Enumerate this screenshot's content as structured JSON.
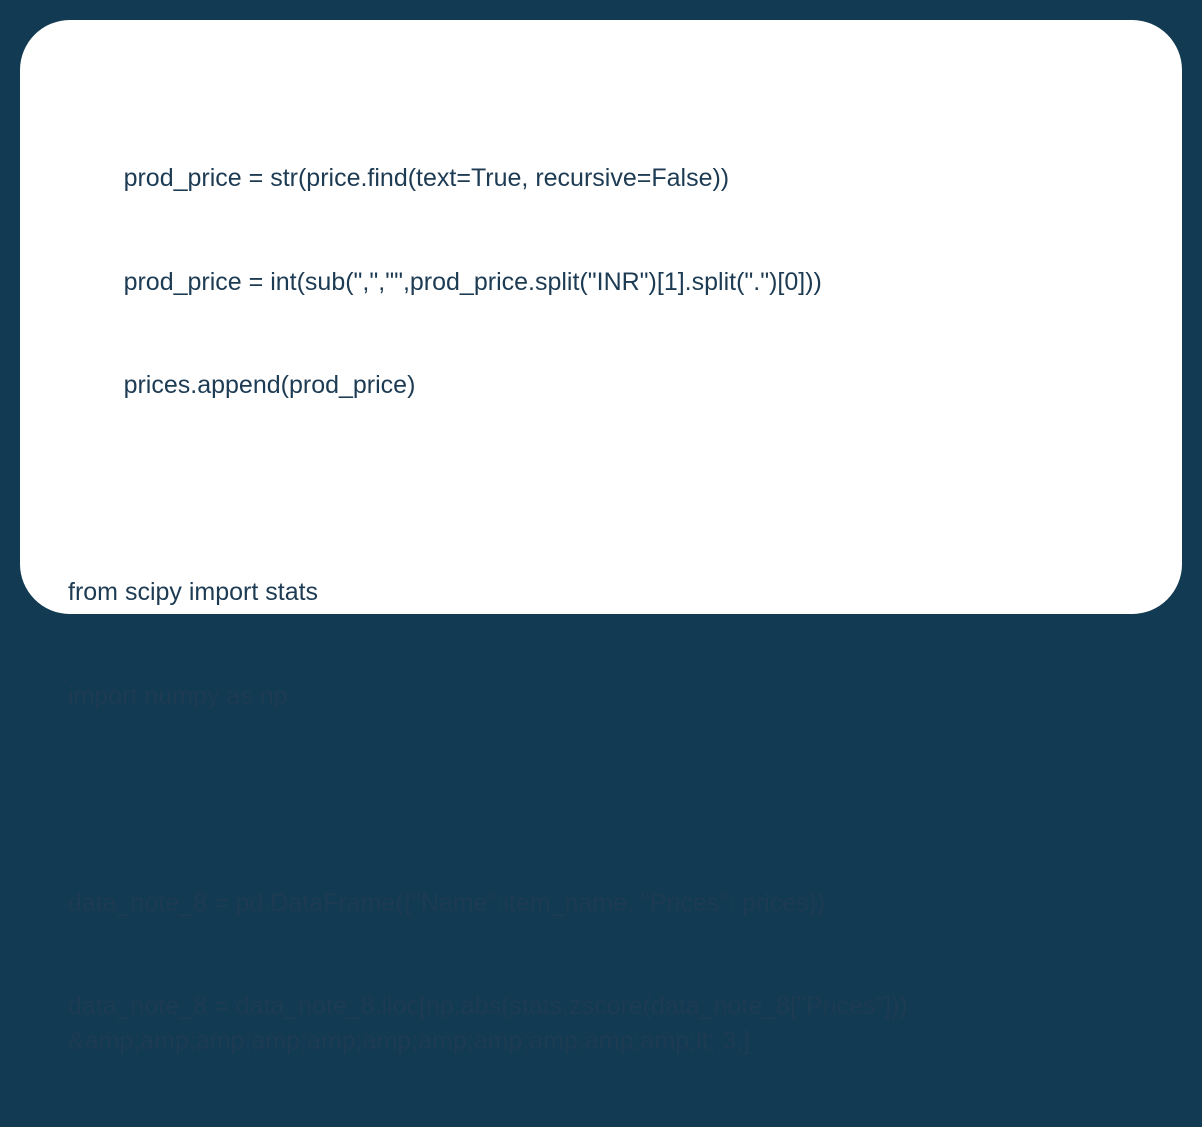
{
  "code": {
    "lines": [
      "        prod_price = str(price.find(text=True, recursive=False))",
      "        prod_price = int(sub(\",\",\"\",prod_price.split(\"INR\")[1].split(\".\")[0]))",
      "        prices.append(prod_price)",
      "",
      "from scipy import stats",
      "import numpy as np",
      "",
      "data_note_8 = pd.DataFrame({\"Name\":item_name, \"Prices\": prices})",
      "data_note_8 = data_note_8.iloc[np.abs(stats.zscore(data_note_8[\"Prices\"])) &amp;amp;amp;amp;amp;amp;amp;amp;amp;amp;amp;lt; 3,]"
    ]
  }
}
